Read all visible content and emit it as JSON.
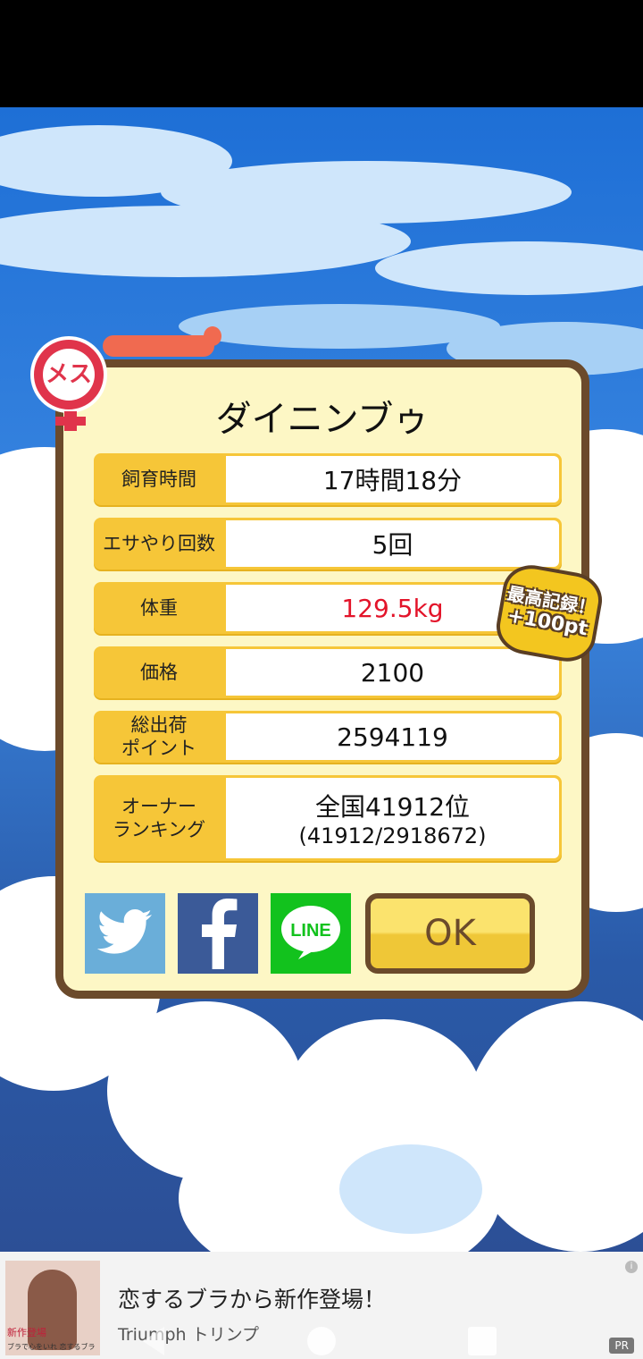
{
  "dialog": {
    "title": "ダイニンブゥ",
    "gender_badge": "メス",
    "rows": [
      {
        "label": "飼育時間",
        "value": "17時間18分"
      },
      {
        "label": "エサやり回数",
        "value": "5回"
      },
      {
        "label": "体重",
        "value": "129.5kg"
      },
      {
        "label": "価格",
        "value": "2100"
      },
      {
        "label": "総出荷\nポイント",
        "value": "2594119"
      },
      {
        "label": "オーナー\nランキング",
        "value": "全国41912位",
        "sub": "(41912/2918672)"
      }
    ],
    "record_badge": {
      "line1": "最高記録！",
      "line2": "+100pt"
    },
    "ok_label": "OK",
    "line_label": "LINE"
  },
  "colors": {
    "dialog_bg": "#fdf7c5",
    "dialog_border": "#6b4a2b",
    "label_bg": "#f6c638",
    "highlight_value": "#e3142a",
    "twitter": "#6aaed9",
    "facebook": "#3b5a98",
    "line": "#12c21d"
  },
  "ad": {
    "title": "恋するブラから新作登場！",
    "advertiser": "Triumph トリンプ",
    "thumb_caption": "新作登場",
    "thumb_caption2": "ブラで心をいれ 恋するブラ",
    "pr": "PR",
    "info": "i"
  }
}
